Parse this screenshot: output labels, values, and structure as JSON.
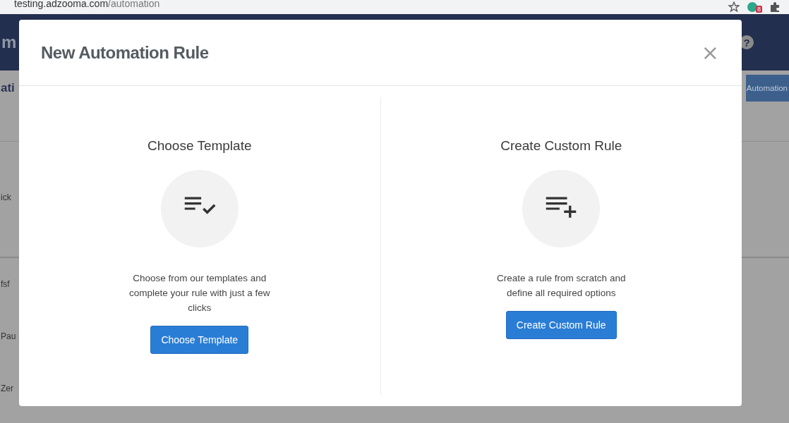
{
  "browser": {
    "url_host": "testing.adzooma.com",
    "url_path": "/automation",
    "extension_badge": "8"
  },
  "background_page": {
    "logo_fragment": "m",
    "help_icon": "?",
    "heading_fragment": "ati",
    "button_fragment": "Automation",
    "rows": [
      "ick",
      "fsf",
      "Pau",
      "Zer"
    ]
  },
  "modal": {
    "title": "New Automation Rule",
    "close": "×",
    "options": [
      {
        "kind": "template",
        "heading": "Choose Template",
        "description": "Choose from our templates and complete your rule with just a few clicks",
        "button": "Choose Template"
      },
      {
        "kind": "custom",
        "heading": "Create Custom Rule",
        "description": "Create a rule from scratch and define all required options",
        "button": "Create Custom Rule"
      }
    ]
  }
}
